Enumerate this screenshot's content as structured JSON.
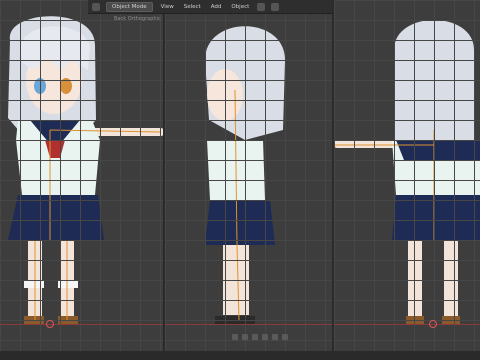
{
  "header": {
    "mode_label": "Object Mode",
    "menus": [
      "View",
      "Select",
      "Add",
      "Object"
    ]
  },
  "info": {
    "line1": "Back Orthographic"
  },
  "colors": {
    "viewport_bg": "#3d3d3d",
    "hair": "#d9dde6",
    "shirt": "#e9f4f0",
    "skirt": "#1d2b55",
    "bone": "#e0922e",
    "axis_x": "#8a3a3a"
  }
}
